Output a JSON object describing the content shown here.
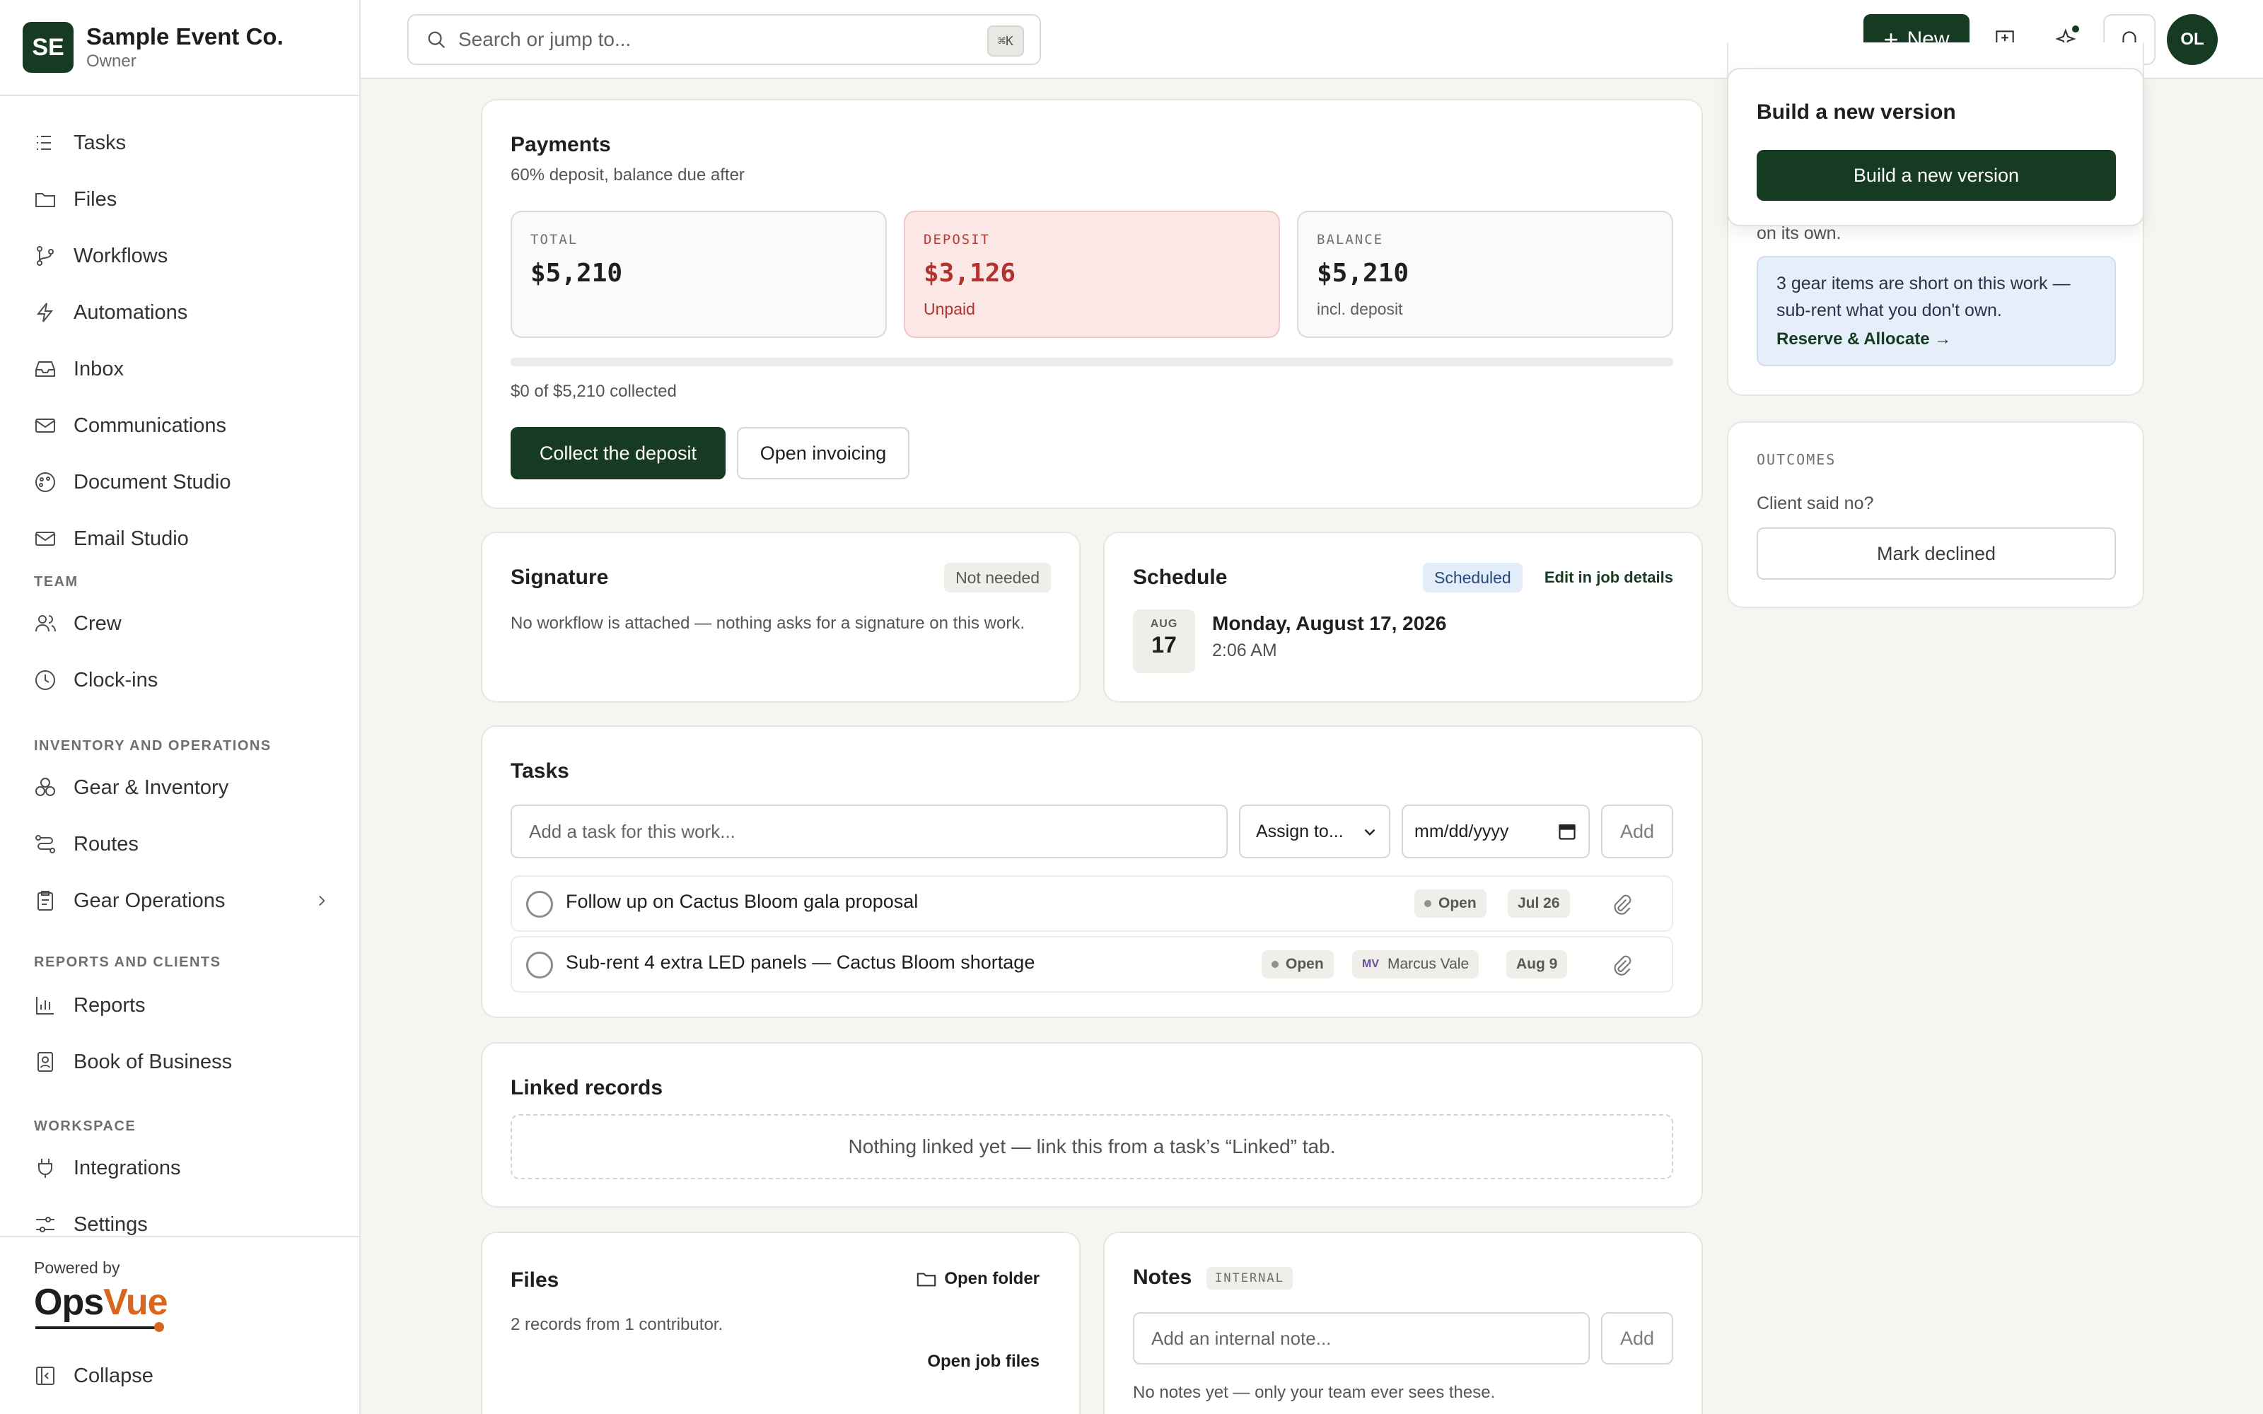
{
  "org": {
    "initials": "SE",
    "name": "Sample Event Co.",
    "role": "Owner"
  },
  "nav": {
    "tasks": "Tasks",
    "files": "Files",
    "workflows": "Workflows",
    "automations": "Automations",
    "inbox": "Inbox",
    "communications": "Communications",
    "document_studio": "Document Studio",
    "email_studio": "Email Studio",
    "section_team": "TEAM",
    "crew": "Crew",
    "clock_ins": "Clock-ins",
    "section_inventory": "INVENTORY AND OPERATIONS",
    "gear_inventory": "Gear & Inventory",
    "routes": "Routes",
    "gear_operations": "Gear Operations",
    "section_reports": "REPORTS AND CLIENTS",
    "reports": "Reports",
    "book_of_business": "Book of Business",
    "section_workspace": "WORKSPACE",
    "integrations": "Integrations",
    "settings": "Settings"
  },
  "footer": {
    "powered_by": "Powered by",
    "brand_ops": "Ops",
    "brand_vue": "Vue",
    "collapse": "Collapse"
  },
  "topbar": {
    "search_placeholder": "Search or jump to...",
    "shortcut": "⌘K",
    "new_label": "New",
    "avatar_initials": "OL"
  },
  "payments": {
    "title": "Payments",
    "subtitle": "60% deposit, balance due after",
    "total": {
      "label": "TOTAL",
      "value": "$5,210"
    },
    "deposit": {
      "label": "DEPOSIT",
      "value": "$3,126",
      "note": "Unpaid"
    },
    "balance": {
      "label": "BALANCE",
      "value": "$5,210",
      "note": "incl. deposit"
    },
    "collected_fraction": 0,
    "collected_text": "$0 of $5,210 collected",
    "collect_button": "Collect the deposit",
    "invoicing_button": "Open invoicing"
  },
  "signature": {
    "title": "Signature",
    "status": "Not needed",
    "text": "No workflow is attached — nothing asks for a signature on this work."
  },
  "schedule": {
    "title": "Schedule",
    "status": "Scheduled",
    "edit_link": "Edit in job details",
    "month": "AUG",
    "day": "17",
    "date_text": "Monday, August 17, 2026",
    "time_text": "2:06 AM"
  },
  "tasks": {
    "title": "Tasks",
    "placeholder": "Add a task for this work...",
    "assign_label": "Assign to...",
    "date_placeholder": "mm/dd/yyyy",
    "add_label": "Add",
    "items": [
      {
        "text": "Follow up on Cactus Bloom gala proposal",
        "status": "Open",
        "due": "Jul 26"
      },
      {
        "text": "Sub-rent 4 extra LED panels — Cactus Bloom shortage",
        "status": "Open",
        "assignee_initials": "MV",
        "assignee": "Marcus Vale",
        "due": "Aug 9"
      }
    ]
  },
  "linked": {
    "title": "Linked records",
    "empty": "Nothing linked yet — link this from a task’s “Linked” tab."
  },
  "files": {
    "title": "Files",
    "open_folder": "Open folder",
    "summary": "2 records from 1 contributor.",
    "open_job_files": "Open job files"
  },
  "notes": {
    "title": "Notes",
    "badge": "INTERNAL",
    "placeholder": "Add an internal note...",
    "add_label": "Add",
    "empty": "No notes yet — only your team ever sees these."
  },
  "right": {
    "popover_title": "Build a new version",
    "popover_button": "Build a new version",
    "peek_text": "on its own.",
    "callout_text": "3 gear items are short on this work — sub-rent what you don't own.",
    "callout_action": "Reserve & Allocate →",
    "outcomes_label": "OUTCOMES",
    "outcomes_question": "Client said no?",
    "mark_declined": "Mark declined"
  }
}
